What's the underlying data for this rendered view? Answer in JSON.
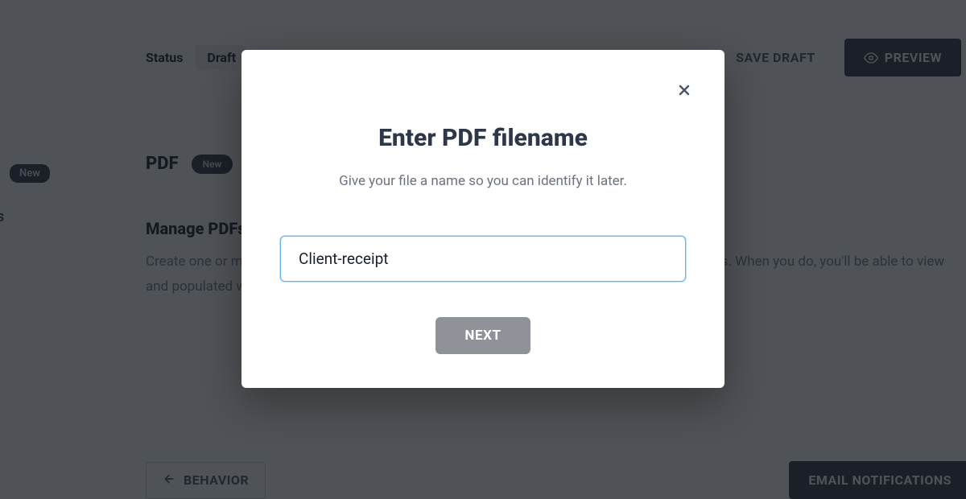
{
  "sidebar": {
    "new_badge": "New",
    "trailing_letter": "s"
  },
  "header": {
    "status_label": "Status",
    "status_value": "Draft",
    "save_draft": "SAVE DRAFT",
    "preview": "PREVIEW"
  },
  "section": {
    "title": "PDF",
    "new_pill": "New"
  },
  "manage": {
    "heading": "Manage PDFs",
    "body_before": "Create one or more fully customizable PDF templates that you want to send to your respondents.",
    "body_after": "When you do, you'll be able to view and populated with each customer's data in the form submissions."
  },
  "footer": {
    "behavior": "BEHAVIOR",
    "email": "EMAIL NOTIFICATIONS"
  },
  "modal": {
    "title": "Enter PDF filename",
    "subtitle": "Give your file a name so you can identify it later.",
    "input_value": "Client-receipt",
    "next": "NEXT"
  }
}
